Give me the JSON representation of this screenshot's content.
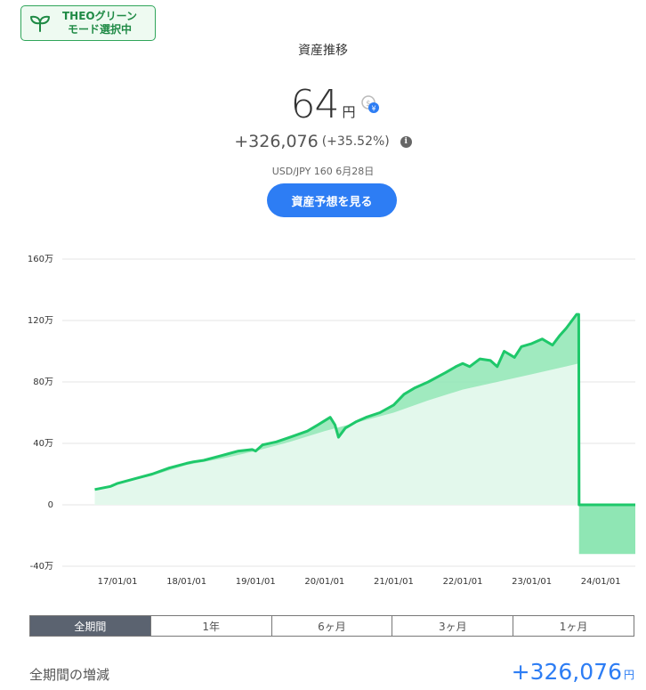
{
  "badge": {
    "line1": "THEOグリーン",
    "line2": "モード選択中"
  },
  "header": {
    "title": "資産推移"
  },
  "valuation": {
    "amount": "64",
    "unit": "円",
    "gain": "+326,076",
    "gain_pct": "(+35.52%)",
    "info_glyph": "i",
    "fx_label": "USD/JPY 160 6月28日"
  },
  "forecast_button": {
    "label": "資産予想を見る"
  },
  "colors": {
    "accent": "#2d7df4",
    "line": "#1ec86a",
    "fill_light": "#e3f8ec",
    "fill_mid": "#8fe6b4"
  },
  "chart_data": {
    "type": "area",
    "y_ticks": [
      {
        "value": 160,
        "label": "160万"
      },
      {
        "value": 120,
        "label": "120万"
      },
      {
        "value": 80,
        "label": "80万"
      },
      {
        "value": 40,
        "label": "40万"
      },
      {
        "value": 0,
        "label": "0"
      },
      {
        "value": -40,
        "label": "-40万"
      }
    ],
    "x_ticks": [
      {
        "year": 2017,
        "label": "17/01/01"
      },
      {
        "year": 2018,
        "label": "18/01/01"
      },
      {
        "year": 2019,
        "label": "19/01/01"
      },
      {
        "year": 2020,
        "label": "20/01/01"
      },
      {
        "year": 2021,
        "label": "21/01/01"
      },
      {
        "year": 2022,
        "label": "22/01/01"
      },
      {
        "year": 2023,
        "label": "23/01/01"
      },
      {
        "year": 2024,
        "label": "24/01/01"
      }
    ],
    "ylim": [
      -40,
      160
    ],
    "grid": true,
    "series": [
      {
        "role": "valuation",
        "points": [
          [
            2016.67,
            10
          ],
          [
            2016.9,
            12
          ],
          [
            2017.0,
            14
          ],
          [
            2017.25,
            17
          ],
          [
            2017.5,
            20
          ],
          [
            2017.75,
            24
          ],
          [
            2018.0,
            27
          ],
          [
            2018.1,
            28
          ],
          [
            2018.25,
            29
          ],
          [
            2018.5,
            32
          ],
          [
            2018.75,
            35
          ],
          [
            2018.95,
            36
          ],
          [
            2019.0,
            35
          ],
          [
            2019.1,
            39
          ],
          [
            2019.3,
            41
          ],
          [
            2019.5,
            44
          ],
          [
            2019.75,
            48
          ],
          [
            2019.9,
            52
          ],
          [
            2020.08,
            57
          ],
          [
            2020.15,
            52
          ],
          [
            2020.2,
            44
          ],
          [
            2020.3,
            50
          ],
          [
            2020.45,
            54
          ],
          [
            2020.6,
            57
          ],
          [
            2020.8,
            60
          ],
          [
            2021.0,
            65
          ],
          [
            2021.15,
            72
          ],
          [
            2021.3,
            76
          ],
          [
            2021.5,
            80
          ],
          [
            2021.75,
            86
          ],
          [
            2021.9,
            90
          ],
          [
            2022.0,
            92
          ],
          [
            2022.1,
            90
          ],
          [
            2022.25,
            95
          ],
          [
            2022.4,
            94
          ],
          [
            2022.5,
            90
          ],
          [
            2022.6,
            100
          ],
          [
            2022.75,
            96
          ],
          [
            2022.85,
            103
          ],
          [
            2023.0,
            105
          ],
          [
            2023.15,
            108
          ],
          [
            2023.3,
            104
          ],
          [
            2023.4,
            110
          ],
          [
            2023.5,
            115
          ],
          [
            2023.65,
            124
          ],
          [
            2023.68,
            124
          ],
          [
            2023.685,
            0
          ],
          [
            2024.5,
            0
          ]
        ]
      },
      {
        "role": "principal",
        "points": [
          [
            2016.67,
            10
          ],
          [
            2017.0,
            14
          ],
          [
            2017.5,
            19
          ],
          [
            2018.0,
            26
          ],
          [
            2018.5,
            30
          ],
          [
            2019.0,
            35
          ],
          [
            2019.5,
            41
          ],
          [
            2020.0,
            48
          ],
          [
            2020.5,
            54
          ],
          [
            2021.0,
            60
          ],
          [
            2021.5,
            68
          ],
          [
            2022.0,
            75
          ],
          [
            2022.5,
            80
          ],
          [
            2023.0,
            85
          ],
          [
            2023.68,
            92
          ],
          [
            2023.685,
            -32
          ],
          [
            2024.5,
            -32
          ]
        ]
      }
    ]
  },
  "tabs": [
    {
      "label": "全期間",
      "active": true
    },
    {
      "label": "1年",
      "active": false
    },
    {
      "label": "6ヶ月",
      "active": false
    },
    {
      "label": "3ヶ月",
      "active": false
    },
    {
      "label": "1ヶ月",
      "active": false
    }
  ],
  "summary": {
    "label": "全期間の増減",
    "value": "+326,076",
    "unit": "円"
  }
}
